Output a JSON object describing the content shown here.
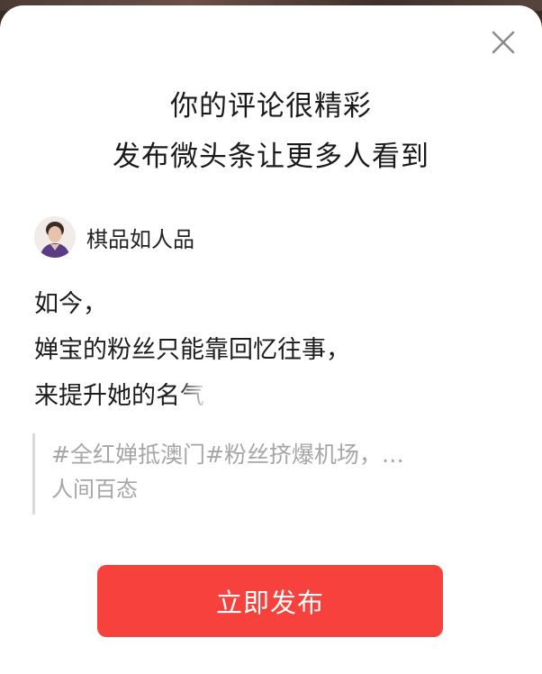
{
  "dialog": {
    "headline_line1": "你的评论很精彩",
    "headline_line2": "发布微头条让更多人看到",
    "close_icon": "close-icon"
  },
  "author": {
    "name": "棋品如人品",
    "avatar_icon": "avatar"
  },
  "comment": {
    "line1": "如今，",
    "line2": "婵宝的粉丝只能靠回忆往事，",
    "line3": "来提升她的名气"
  },
  "quote": {
    "text": "#全红婵抵澳门#粉丝挤爆机场，…",
    "source": "人间百态"
  },
  "actions": {
    "publish_label": "立即发布"
  },
  "colors": {
    "accent": "#f6413d",
    "quote_text": "#a6a6a6",
    "title": "#1a1a1a"
  }
}
